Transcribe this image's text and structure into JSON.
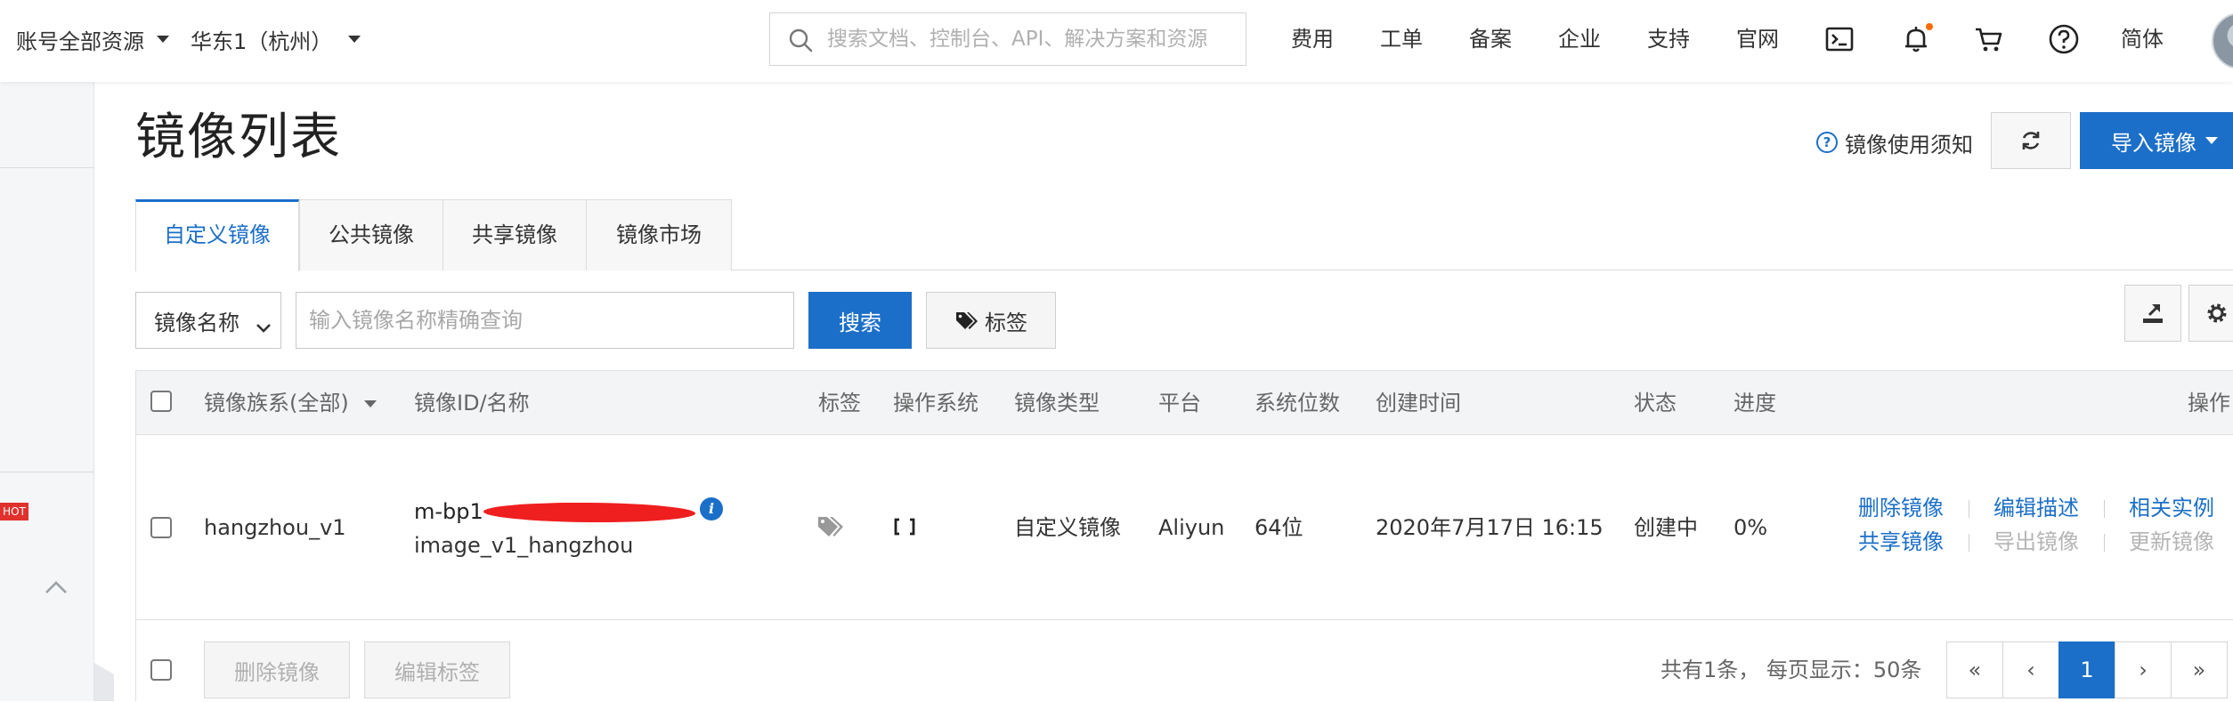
{
  "topbar": {
    "account_scope": "账号全部资源",
    "region": "华东1（杭州）",
    "search_placeholder": "搜索文档、控制台、API、解决方案和资源",
    "nav": [
      "费用",
      "工单",
      "备案",
      "企业",
      "支持",
      "官网"
    ],
    "icons": [
      "terminal-icon",
      "bell-icon",
      "cart-icon",
      "help-icon"
    ],
    "language": "简体"
  },
  "sidebar": {
    "hot_badge": "HOT"
  },
  "header": {
    "title": "镜像列表",
    "help_link": "镜像使用须知",
    "import_button": "导入镜像"
  },
  "tabs": [
    {
      "label": "自定义镜像",
      "active": true
    },
    {
      "label": "公共镜像",
      "active": false
    },
    {
      "label": "共享镜像",
      "active": false
    },
    {
      "label": "镜像市场",
      "active": false
    }
  ],
  "filter": {
    "field_select": "镜像名称",
    "input_placeholder": "输入镜像名称精确查询",
    "search_button": "搜索",
    "tag_button": "标签"
  },
  "table": {
    "columns": [
      "镜像族系(全部)",
      "镜像ID/名称",
      "标签",
      "操作系统",
      "镜像类型",
      "平台",
      "系统位数",
      "创建时间",
      "状态",
      "进度",
      "操作"
    ],
    "rows": [
      {
        "family": "hangzhou_v1",
        "image_id": "m-bp1",
        "image_name": "image_v1_hangzhou",
        "image_type": "自定义镜像",
        "platform": "Aliyun",
        "bits": "64位",
        "created": "2020年7月17日 16:15",
        "status": "创建中",
        "progress": "0%",
        "actions": {
          "delete": "删除镜像",
          "edit_desc": "编辑描述",
          "related": "相关实例",
          "share": "共享镜像",
          "export": "导出镜像",
          "update": "更新镜像"
        }
      }
    ]
  },
  "footer": {
    "delete_button": "删除镜像",
    "edit_tags_button": "编辑标签",
    "summary": "共有1条， 每页显示：50条",
    "pagination": {
      "first": "«",
      "prev": "‹",
      "current": "1",
      "next": "›",
      "last": "»"
    }
  },
  "colors": {
    "primary": "#1c6fc8",
    "hot": "#e0312c",
    "notify_dot": "#ff6a00"
  }
}
